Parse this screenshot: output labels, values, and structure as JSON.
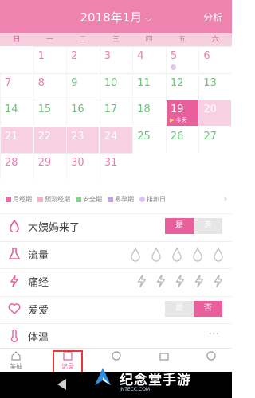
{
  "header": {
    "title": "2018年1月",
    "action": "分析"
  },
  "weekdays": [
    "日",
    "一",
    "二",
    "三",
    "四",
    "五",
    "六"
  ],
  "calendar": {
    "days": [
      {
        "n": "1",
        "t": "pred"
      },
      {
        "n": "2",
        "t": "pred"
      },
      {
        "n": "3",
        "t": "pred"
      },
      {
        "n": "4",
        "t": "pred"
      },
      {
        "n": "5",
        "t": "pred",
        "dot": true
      },
      {
        "n": "6",
        "t": "pred"
      },
      {
        "n": "7",
        "t": "pred"
      },
      {
        "n": "8",
        "t": "pred"
      },
      {
        "n": "9",
        "t": "safe"
      },
      {
        "n": "10",
        "t": "safe"
      },
      {
        "n": "11",
        "t": "safe"
      },
      {
        "n": "12",
        "t": "safe"
      },
      {
        "n": "13",
        "t": "safe"
      },
      {
        "n": "14",
        "t": "safe"
      },
      {
        "n": "15",
        "t": "safe"
      },
      {
        "n": "16",
        "t": "safe"
      },
      {
        "n": "17",
        "t": "safe"
      },
      {
        "n": "18",
        "t": "safe"
      },
      {
        "n": "19",
        "t": "today",
        "tag": "今天"
      },
      {
        "n": "20",
        "t": "period"
      },
      {
        "n": "21",
        "t": "period"
      },
      {
        "n": "22",
        "t": "period"
      },
      {
        "n": "23",
        "t": "period"
      },
      {
        "n": "24",
        "t": "period"
      },
      {
        "n": "25",
        "t": "safe"
      },
      {
        "n": "26",
        "t": "safe"
      },
      {
        "n": "27",
        "t": "safe"
      },
      {
        "n": "28",
        "t": "pred"
      },
      {
        "n": "29",
        "t": "pred"
      },
      {
        "n": "30",
        "t": "pred"
      },
      {
        "n": "31",
        "t": "pred"
      }
    ],
    "first_weekday": 1
  },
  "legend": [
    {
      "label": "月经期",
      "color": "#ef6aa6"
    },
    {
      "label": "预测经期",
      "color": "#f4b0cf"
    },
    {
      "label": "安全期",
      "color": "#86d08f"
    },
    {
      "label": "易孕期",
      "color": "#c7a2e0"
    },
    {
      "label": "排卵日",
      "color": "#e0c0f0",
      "round": true
    }
  ],
  "records": {
    "period_came": {
      "label": "大姨妈来了",
      "yes": "是",
      "no": "否"
    },
    "flow": {
      "label": "流量"
    },
    "cramps": {
      "label": "痛经"
    },
    "love": {
      "label": "爱爱",
      "yes": "是",
      "no": "否"
    },
    "temp": {
      "label": "体温",
      "more": "···"
    }
  },
  "tabs": [
    {
      "label": "美柚"
    },
    {
      "label": "记录"
    }
  ],
  "brand": {
    "name": "纪念堂手游",
    "url": "JNTECC.COM"
  },
  "colors": {
    "accent": "#e85f9c",
    "header": "#ef83b0"
  }
}
